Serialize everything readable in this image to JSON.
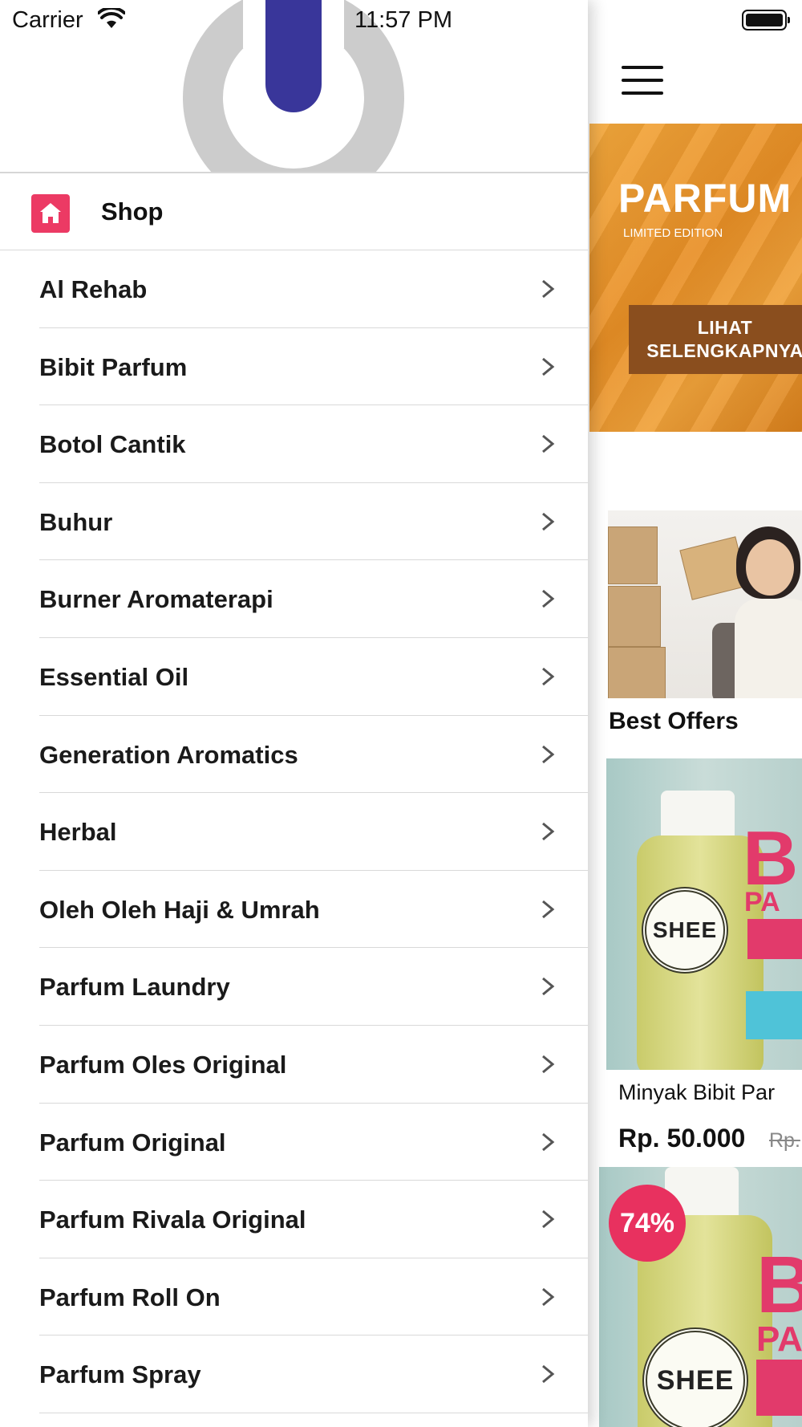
{
  "status_bar": {
    "carrier": "Carrier",
    "time": "11:57 PM"
  },
  "drawer": {
    "shop_label": "Shop",
    "categories": [
      "Al Rehab",
      "Bibit Parfum",
      "Botol Cantik",
      "Buhur",
      "Burner Aromaterapi",
      "Essential Oil",
      "Generation Aromatics",
      "Herbal",
      "Oleh Oleh Haji & Umrah",
      "Parfum Laundry",
      "Parfum Oles Original",
      "Parfum Original",
      "Parfum Rivala Original",
      "Parfum Roll On",
      "Parfum Spray"
    ]
  },
  "main": {
    "banner": {
      "title": "PARFUM",
      "subtitle": "LIMITED EDITION",
      "button_label": "LIHAT SELENGKAPNYA"
    },
    "section_title": "Best Offers",
    "products": [
      {
        "name": "Minyak Bibit Par",
        "price": "Rp. 50.000",
        "old_price": "Rp.",
        "image_label": "SHEE"
      },
      {
        "discount": "74%",
        "image_label": "SHEE"
      }
    ]
  },
  "colors": {
    "accent": "#ec3a64",
    "logo_blue": "#39369a",
    "logo_gray": "#cccccc",
    "banner_orange": "#e88f26"
  }
}
